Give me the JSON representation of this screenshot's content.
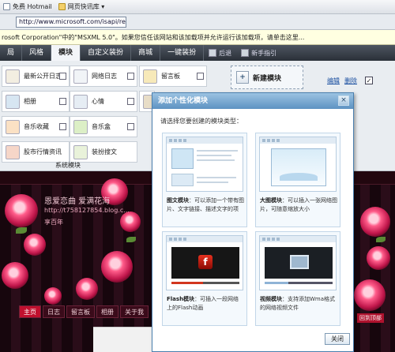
{
  "browser": {
    "favorites": [
      {
        "label": "免费 Hotmail",
        "icon": "page-icon"
      },
      {
        "label": "网页快讯库 ▾",
        "icon": "folder-icon"
      }
    ],
    "address": "http://www.microsoft.com/isapi/redir.dll?...",
    "infobar": "rosoft Corporation\"中的\"MSXML 5.0\"。如果您信任该网站和该加载项并允许运行该加载项，请单击这里..."
  },
  "tabs": [
    {
      "label": "局"
    },
    {
      "label": "风格"
    },
    {
      "label": "模块",
      "active": true
    },
    {
      "label": "自定义装扮"
    },
    {
      "label": "商城"
    },
    {
      "label": "一键装扮"
    }
  ],
  "toolbar": {
    "undo_label": "后退",
    "new_label": "新手指引"
  },
  "modules": [
    {
      "label": "最新公开日志",
      "icon": "document-icon"
    },
    {
      "label": "网络日志",
      "icon": "pencil-icon"
    },
    {
      "label": "留言板",
      "icon": "note-icon"
    },
    {
      "label": "相册",
      "icon": "photo-icon"
    },
    {
      "label": "心情",
      "icon": "chat-icon"
    },
    {
      "label": "",
      "icon": "house-icon"
    },
    {
      "label": "音乐收藏",
      "icon": "music-icon"
    },
    {
      "label": "音乐盒",
      "icon": "music-box-icon"
    },
    {
      "label": "股市行情资讯",
      "icon": "chart-icon"
    },
    {
      "label": "装扮搜文",
      "icon": "search-icon"
    }
  ],
  "system_modules_label": "系统模块",
  "new_module": {
    "label": "新建模块",
    "edit": "编辑",
    "delete": "删除",
    "checked": "✓"
  },
  "dialog": {
    "title": "添加个性化模块",
    "close": "×",
    "prompt": "请选择您要创建的模块类型：",
    "cards": [
      {
        "name": "图文模块",
        "desc": "：可以添加一个带有图片、文字链接、描述文字的项"
      },
      {
        "name": "大图模块",
        "desc": "：可以插入一张网络图片，可随意缩放大小"
      },
      {
        "name": "Flash模块",
        "desc": "：可插入一段网络上的Flash动画"
      },
      {
        "name": "视频模块",
        "desc": "：支持添加Wma格式的网络视频文件"
      }
    ],
    "close_button": "关闭"
  },
  "blog": {
    "title": "恩爱恋曲  爱满花海",
    "url": "http://t758127854.blog.c...",
    "sub": "享百年",
    "nav": [
      {
        "label": "主页",
        "active": true
      },
      {
        "label": "日志"
      },
      {
        "label": "留言板"
      },
      {
        "label": "相册"
      },
      {
        "label": "关于我"
      }
    ],
    "badge": "回到顶部"
  },
  "colors": {
    "accent": "#5d92c2",
    "tabbar": "#2a3038",
    "blog_red": "#c0102e"
  }
}
